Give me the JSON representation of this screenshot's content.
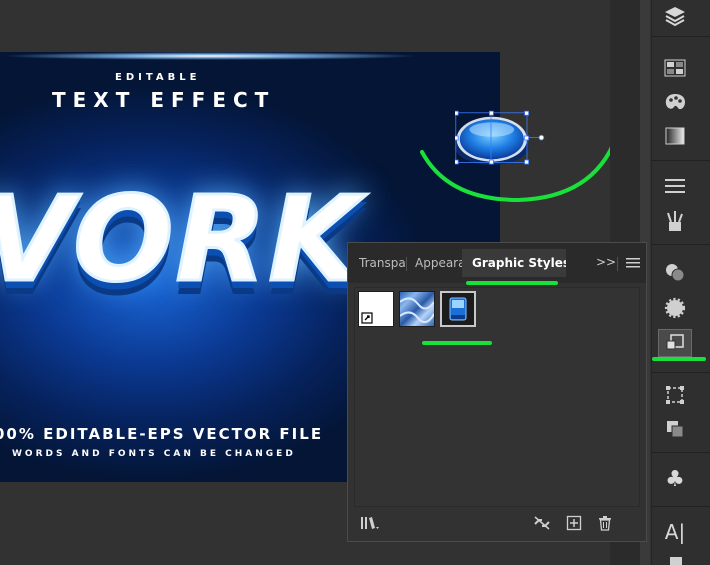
{
  "artboard": {
    "editable": "EDITABLE",
    "text_effect": "TEXT EFFECT",
    "big_word": "VORK",
    "editable_eps": "00% EDITABLE-EPS VECTOR FILE",
    "words_fonts": "WORDS AND FONTS CAN BE CHANGED"
  },
  "panel": {
    "tabs": [
      {
        "label": "Transparency",
        "active": false
      },
      {
        "label": "Appearance",
        "active": false
      },
      {
        "label": "Graphic Styles",
        "active": true
      }
    ],
    "overflow_label": ">>",
    "swatches": [
      {
        "name": "Default Graphic Style",
        "icon": "default-style"
      },
      {
        "name": "Blue pattern style",
        "icon": "pattern"
      },
      {
        "name": "Blue button style",
        "icon": "button",
        "selected": true
      }
    ],
    "footer_icons": [
      "library-icon",
      "break-link-icon",
      "new-style-icon",
      "trash-icon"
    ]
  },
  "tool_strip": {
    "tools": [
      "layers-icon",
      "swatches-icon",
      "color-icon",
      "gradient-icon",
      "stroke-icon",
      "brushes-icon",
      "appearance-icon",
      "transparency-icon",
      "graphic-styles-icon",
      "transform-icon",
      "pathfinder-icon",
      "symbols-icon",
      "character-icon"
    ],
    "active_tool": "graphic-styles-icon"
  },
  "colors": {
    "highlight_green": "#19e03a",
    "panel_bg": "#323232",
    "artboard_blue": "#0b3a94"
  }
}
